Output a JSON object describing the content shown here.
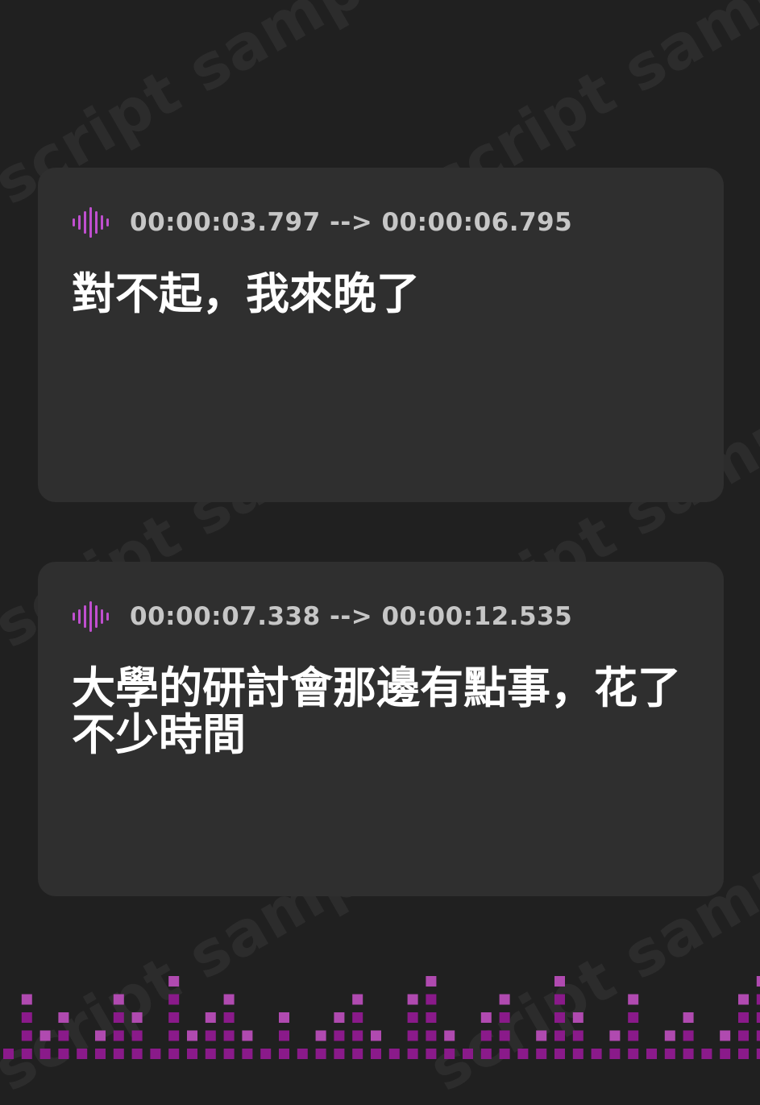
{
  "watermark": {
    "text": "script sample"
  },
  "cards": [
    {
      "icon": "audio-waveform-icon",
      "timestamp": "00:00:03.797 --> 00:00:06.795",
      "text": "對不起，我來晚了"
    },
    {
      "icon": "audio-waveform-icon",
      "timestamp": "00:00:07.338 --> 00:00:12.535",
      "text": "大學的研討會那邊有點事，花了不少時間"
    }
  ],
  "colors": {
    "background": "#202020",
    "card": "#2f2f2f",
    "timestamp": "#c6c6c6",
    "text": "#ffffff",
    "accent": "#c04fd0",
    "equalizer_dark": "#8a1a8a",
    "equalizer_light": "#b04ab0"
  },
  "equalizer": {
    "levels": [
      1,
      4,
      2,
      3,
      1,
      2,
      4,
      3,
      1,
      5,
      2,
      3,
      4,
      2,
      1,
      3,
      1,
      2,
      3,
      4,
      2,
      1,
      4,
      5,
      2,
      1,
      3,
      4,
      1,
      2,
      5,
      3,
      1,
      2,
      4,
      1,
      2,
      3,
      1,
      2,
      4,
      5,
      2,
      3,
      4,
      1,
      2,
      3,
      1,
      2
    ]
  }
}
